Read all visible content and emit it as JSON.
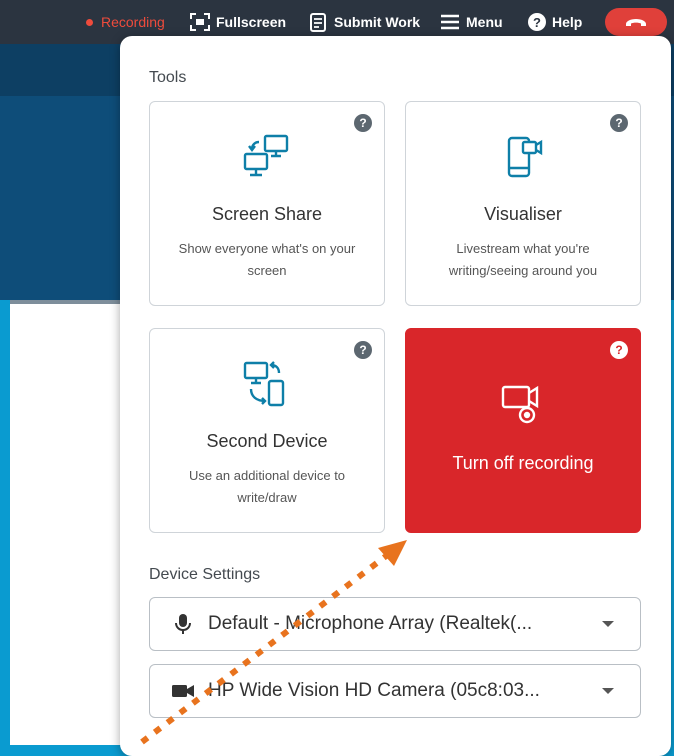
{
  "topbar": {
    "recording_label": "Recording",
    "fullscreen_label": "Fullscreen",
    "submit_label": "Submit Work",
    "menu_label": "Menu",
    "help_label": "Help"
  },
  "panel": {
    "tools_label": "Tools",
    "tiles": [
      {
        "title": "Screen Share",
        "description": "Show everyone what's on your screen",
        "icon": "screen-share-icon"
      },
      {
        "title": "Visualiser",
        "description": "Livestream what you're writing/seeing around you",
        "icon": "visualiser-icon"
      },
      {
        "title": "Second Device",
        "description": "Use an additional device to write/draw",
        "icon": "second-device-icon"
      },
      {
        "title": "Turn off recording",
        "description": "",
        "icon": "record-video-icon"
      }
    ],
    "device_settings_label": "Device Settings",
    "microphone_value": "Default - Microphone Array (Realtek(...",
    "camera_value": "HP Wide Vision HD Camera (05c8:03..."
  },
  "colors": {
    "accent_red": "#d9262a",
    "topbar": "#2b3440",
    "annotation_arrow": "#e8731e"
  }
}
